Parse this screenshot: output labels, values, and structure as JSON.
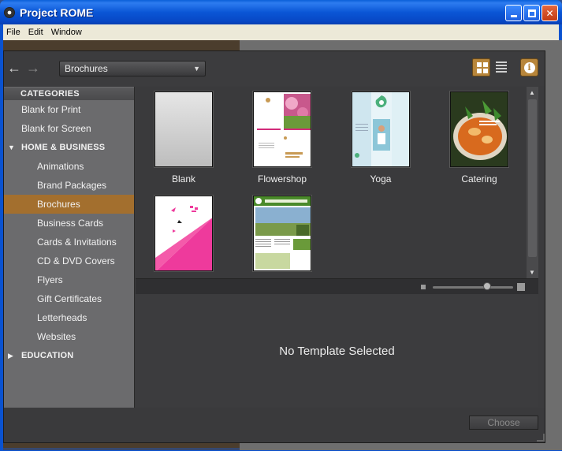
{
  "window": {
    "title": "Project ROME"
  },
  "menu": [
    "File",
    "Edit",
    "Window"
  ],
  "toolbar": {
    "category_select": "Brochures",
    "back_glyph": "←",
    "forward_glyph": "→",
    "caret_glyph": "▼"
  },
  "sidebar": {
    "header": "CATEGORIES",
    "items": [
      {
        "label": "Blank for Print",
        "level": 1
      },
      {
        "label": "Blank for Screen",
        "level": 1
      },
      {
        "label": "HOME & BUSINESS",
        "level": 0,
        "group": true,
        "expanded": true
      },
      {
        "label": "Animations",
        "level": 2
      },
      {
        "label": "Brand Packages",
        "level": 2
      },
      {
        "label": "Brochures",
        "level": 2,
        "selected": true
      },
      {
        "label": "Business Cards",
        "level": 2
      },
      {
        "label": "Cards & Invitations",
        "level": 2
      },
      {
        "label": "CD & DVD Covers",
        "level": 2
      },
      {
        "label": "Flyers",
        "level": 2
      },
      {
        "label": "Gift Certificates",
        "level": 2
      },
      {
        "label": "Letterheads",
        "level": 2
      },
      {
        "label": "Websites",
        "level": 2
      },
      {
        "label": "EDUCATION",
        "level": 0,
        "group": true,
        "expanded": false
      }
    ]
  },
  "templates": [
    {
      "label": "Blank"
    },
    {
      "label": "Flowershop"
    },
    {
      "label": "Yoga"
    },
    {
      "label": "Catering"
    },
    {
      "label": ""
    },
    {
      "label": ""
    }
  ],
  "detail": {
    "empty_text": "No Template Selected"
  },
  "footer": {
    "choose_label": "Choose"
  },
  "colors": {
    "accent": "#a36f2e",
    "dialog_bg": "#3b3b3d",
    "sidebar_bg": "#6b6b6d"
  }
}
